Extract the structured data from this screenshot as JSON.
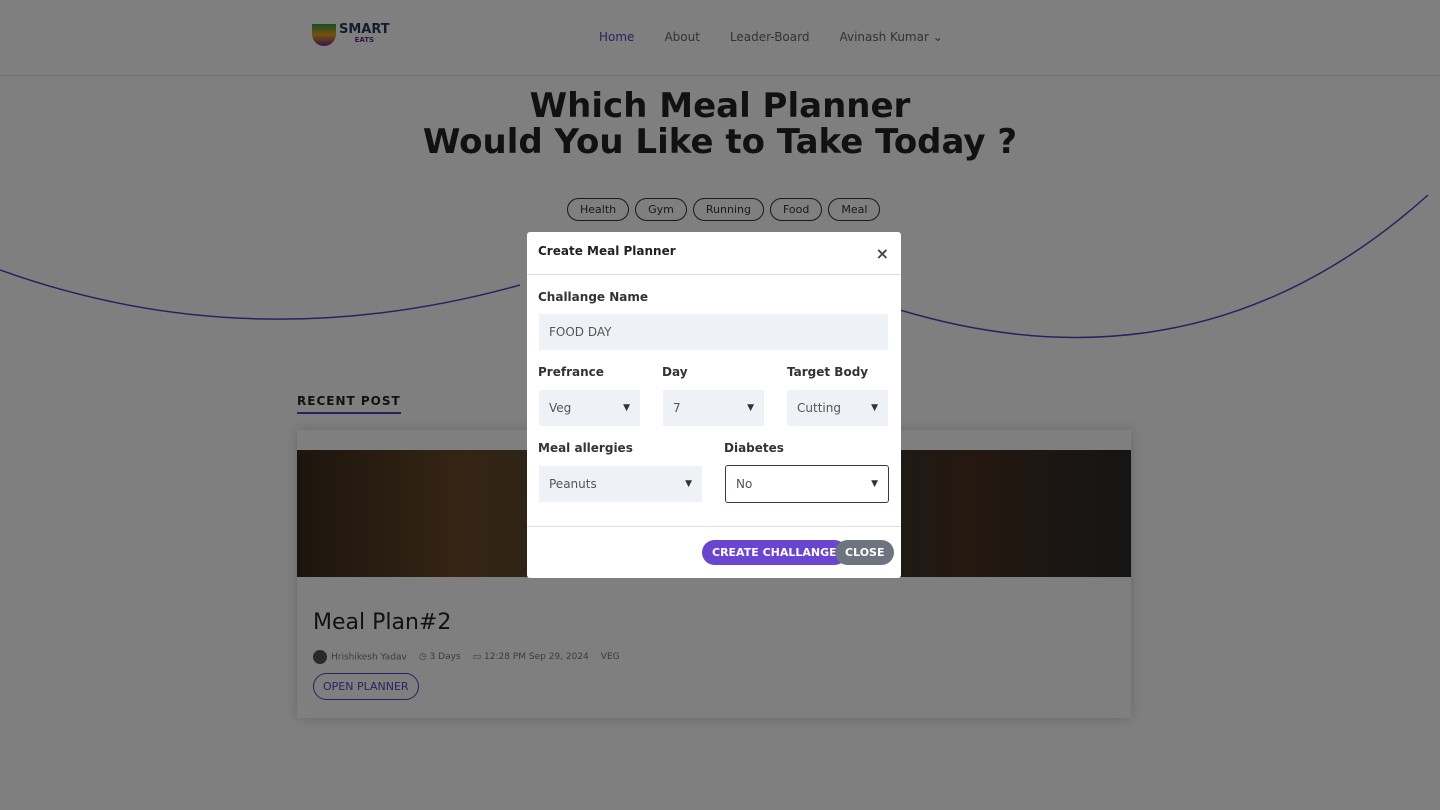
{
  "nav": {
    "logo_top": "SMART",
    "logo_bottom": "EATS",
    "items": [
      "Home",
      "About",
      "Leader-Board",
      "Avinash Kumar"
    ]
  },
  "hero": {
    "line1": "Which Meal Planner",
    "line2": "Would You Like to Take Today ?"
  },
  "tags": [
    "Health",
    "Gym",
    "Running",
    "Food",
    "Meal"
  ],
  "recent": {
    "heading": "RECENT POST",
    "title": "Meal Plan#2",
    "author": "Hrishikesh Yadav",
    "days": "3 Days",
    "date": "12:28 PM Sep 29, 2024",
    "badge": "VEG",
    "open": "OPEN PLANNER"
  },
  "modal": {
    "title": "Create Meal Planner",
    "close_icon": "×",
    "name_label": "Challange Name",
    "name_value": "FOOD DAY",
    "pref_label": "Prefrance",
    "pref_value": "Veg",
    "day_label": "Day",
    "day_value": "7",
    "target_label": "Target Body",
    "target_value": "Cutting",
    "allergy_label": "Meal allergies",
    "allergy_value": "Peanuts",
    "diabetes_label": "Diabetes",
    "diabetes_value": "No",
    "create": "CREATE CHALLANGE",
    "close": "CLOSE"
  },
  "colors": {
    "accent": "#5a3fc0",
    "close_btn": "#6c757d"
  }
}
